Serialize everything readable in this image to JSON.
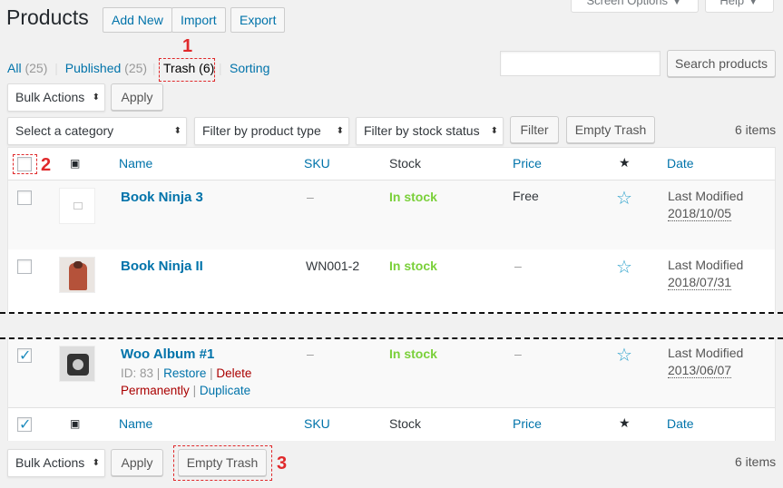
{
  "header": {
    "title": "Products",
    "add_new": "Add New",
    "import": "Import",
    "export": "Export",
    "screen_options": "Screen Options ▼",
    "help": "Help ▼"
  },
  "subsubsub": {
    "all": "All",
    "all_count": "(25)",
    "published": "Published",
    "published_count": "(25)",
    "trash": "Trash (6)",
    "sorting": "Sorting",
    "sep": "|"
  },
  "search": {
    "value": "",
    "button": "Search products"
  },
  "bulk": {
    "label": "Bulk Actions",
    "apply": "Apply"
  },
  "filters": {
    "category": "Select a category",
    "product_type": "Filter by product type",
    "stock_status": "Filter by stock status",
    "filter": "Filter",
    "empty_trash": "Empty Trash"
  },
  "items_count": "6 items",
  "columns": {
    "name": "Name",
    "sku": "SKU",
    "stock": "Stock",
    "price": "Price",
    "star": "★",
    "date": "Date"
  },
  "rows": [
    {
      "name": "Book Ninja 3",
      "sku": "–",
      "stock": "In stock",
      "price": "Free",
      "date_label": "Last Modified",
      "date": "2018/10/05",
      "checked": false
    },
    {
      "name": "Book Ninja II",
      "sku": "WN001-2",
      "stock": "In stock",
      "price": "–",
      "date_label": "Last Modified",
      "date": "2018/07/31",
      "checked": false
    },
    {
      "name": "Woo Album #1",
      "sku": "–",
      "stock": "In stock",
      "price": "–",
      "date_label": "Last Modified",
      "date": "2013/06/07",
      "checked": true,
      "row_actions": {
        "id": "ID: 83",
        "sep": "|",
        "restore": "Restore",
        "delete_1": "Delete",
        "delete_2": "Permanently",
        "duplicate": "Duplicate"
      }
    }
  ],
  "annotations": {
    "one": "1",
    "two": "2",
    "three": "3"
  },
  "colors": {
    "accent": "#0073aa",
    "instock": "#7ad03a",
    "annotation": "#e0292b",
    "delete": "#a00"
  },
  "icons": {
    "image_column": "image-icon",
    "featured_column": "star-icon",
    "featured_row": "star-outline-icon"
  }
}
